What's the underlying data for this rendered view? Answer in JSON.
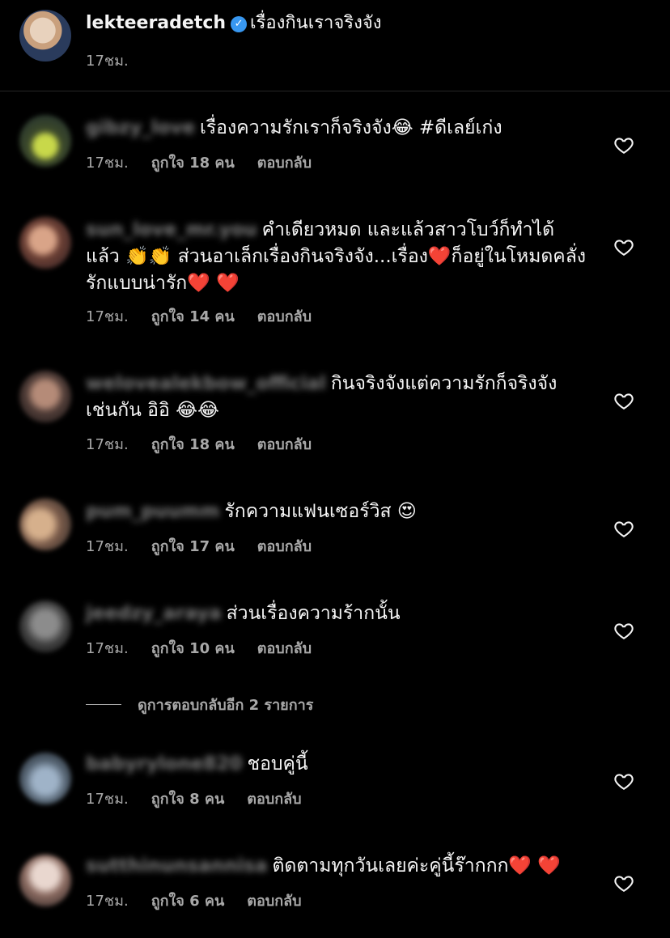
{
  "post": {
    "username": "lekteeradetch",
    "caption": "เรื่องกินเราจริงจัง",
    "time": "17ชม."
  },
  "labels": {
    "reply": "ตอบกลับ",
    "view_more_replies": "ดูการตอบกลับอีก 2 รายการ"
  },
  "comments": [
    {
      "username": "gibzy_love",
      "text": "เรื่องความรักเราก็จริงจัง😂 #ดีเลย์เก่ง",
      "time": "17ชม.",
      "likes": "ถูกใจ 18 คน"
    },
    {
      "username": "sun_love_mr.you",
      "text": "คำเดียวหมด และแล้วสาวโบว์ก็ทำได้แล้ว 👏👏 ส่วนอาเล็กเรื่องกินจริงจัง...เรื่อง❤️ก็อยู่ในโหมดคลั่งรักแบบน่ารัก❤️ ❤️",
      "time": "17ชม.",
      "likes": "ถูกใจ 14 คน"
    },
    {
      "username": "welovealekbow_official",
      "text": "กินจริงจังแต่ความรักก็จริงจังเช่นกัน อิอิ 😂😂",
      "time": "17ชม.",
      "likes": "ถูกใจ 18 คน"
    },
    {
      "username": "pum_puumm",
      "text": "รักความแฟนเซอร์วิส 😍",
      "time": "17ชม.",
      "likes": "ถูกใจ 17 คน"
    },
    {
      "username": "jeedzy_araya",
      "text": "ส่วนเรื่องความร้ากนั้น",
      "time": "17ชม.",
      "likes": "ถูกใจ 10 คน"
    },
    {
      "username": "babyrylone820",
      "text": "ชอบคู่นี้",
      "time": "17ชม.",
      "likes": "ถูกใจ 8 คน"
    },
    {
      "username": "sutthinunsannisa",
      "text": "ติดตามทุกวันเลยค่ะคู่นี้ร๊ากกก❤️ ❤️",
      "time": "17ชม.",
      "likes": "ถูกใจ 6 คน"
    }
  ],
  "colors": {
    "background": "#000000",
    "text": "#f5f5f5",
    "secondary": "#a8a8a8",
    "verified": "#3897f0"
  }
}
